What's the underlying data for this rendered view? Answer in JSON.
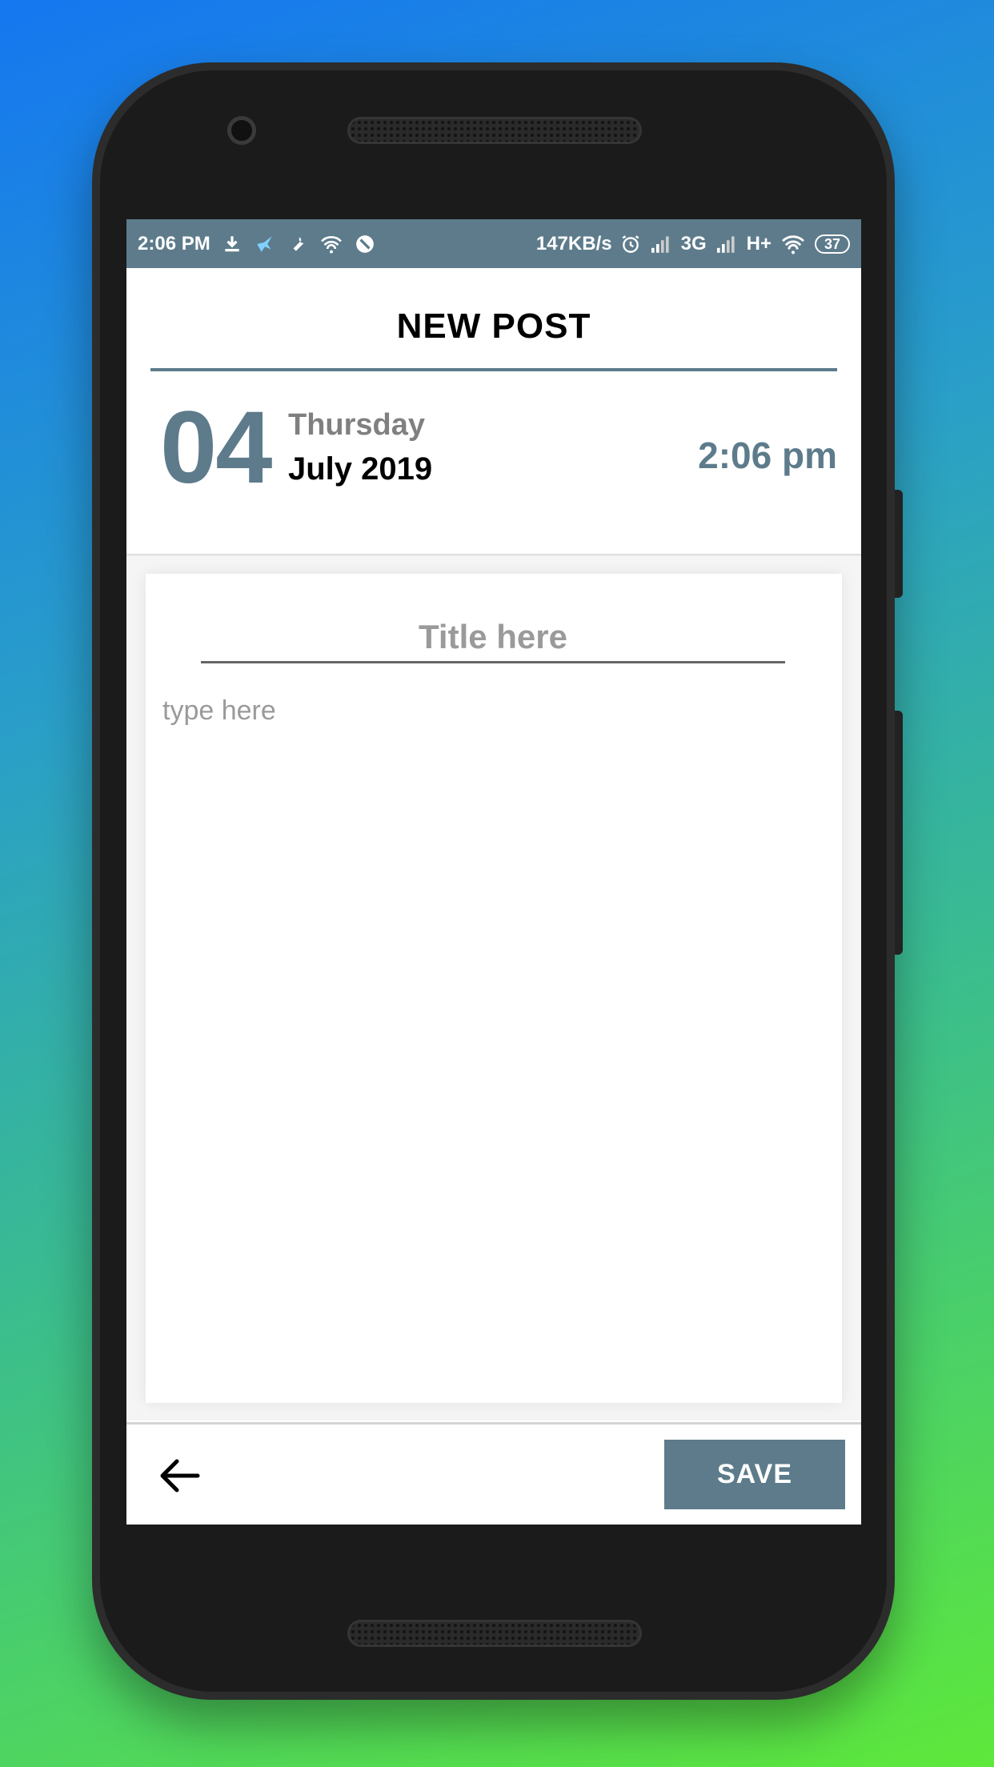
{
  "status_bar": {
    "time": "2:06 PM",
    "speed": "147KB/s",
    "network_3g": "3G",
    "network_hplus": "H+",
    "battery": "37"
  },
  "header": {
    "title": "NEW POST"
  },
  "date": {
    "day": "04",
    "weekday": "Thursday",
    "month_year": "July 2019",
    "time": "2:06 pm"
  },
  "editor": {
    "title_placeholder": "Title here",
    "body_placeholder": "type here"
  },
  "footer": {
    "save_label": "SAVE"
  },
  "colors": {
    "accent": "#5d7b8b",
    "status_bar": "#5d7b8b",
    "text_primary": "#000000",
    "text_muted": "#808080"
  },
  "icons": [
    "download-icon",
    "bird-icon",
    "wrench-icon",
    "wifi-icon",
    "block-icon",
    "alarm-icon",
    "signal-icon",
    "battery-icon",
    "back-arrow-icon"
  ]
}
